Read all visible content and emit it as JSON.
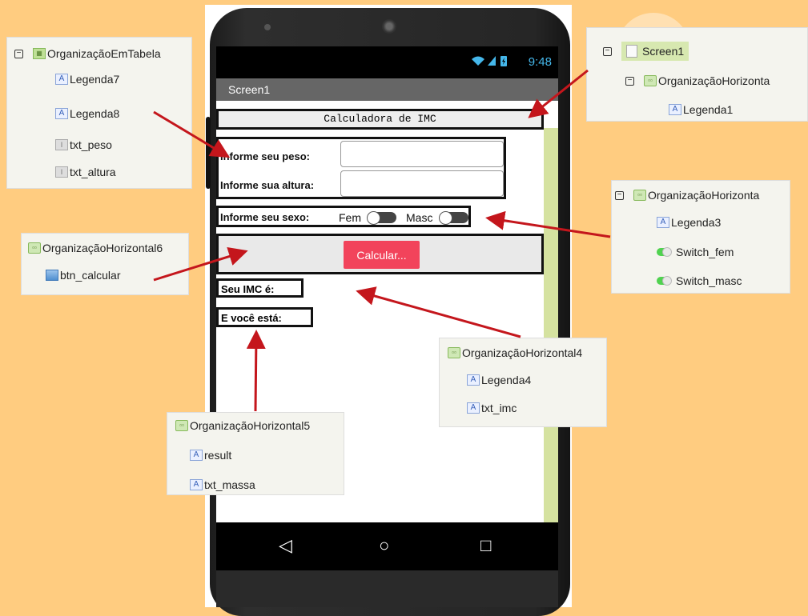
{
  "phone": {
    "status_time": "9:48",
    "status_icons": "signal-wifi-battery-icons",
    "screen_title": "Screen1",
    "app_title": "Calculadora de IMC",
    "form": {
      "peso_label": "Informe seu peso:",
      "altura_label": "Informe sua altura:",
      "sexo_label": "Informe seu sexo:",
      "fem_label": "Fem",
      "masc_label": "Masc"
    },
    "calc_button": "Calcular...",
    "imc_label": "Seu IMC é:",
    "massa_label": "E você está:",
    "nav": {
      "back": "◁",
      "home": "○",
      "recent": "□"
    }
  },
  "panels": {
    "tabela": {
      "title": "OrganizaçãoEmTabela",
      "children": [
        "Legenda7",
        "Legenda8",
        "txt_peso",
        "txt_altura"
      ]
    },
    "screen": {
      "title": "Screen1",
      "child": "OrganizaçãoHorizonta",
      "grandchild": "Legenda1"
    },
    "sexo": {
      "title": "OrganizaçãoHorizonta",
      "children": [
        "Legenda3",
        "Switch_fem",
        "Switch_masc"
      ]
    },
    "h6": {
      "title": "OrganizaçãoHorizontal6",
      "children": [
        "btn_calcular"
      ]
    },
    "h4": {
      "title": "OrganizaçãoHorizontal4",
      "children": [
        "Legenda4",
        "txt_imc"
      ]
    },
    "h5": {
      "title": "OrganizaçãoHorizontal5",
      "children": [
        "result",
        "txt_massa"
      ]
    }
  },
  "colors": {
    "background": "#ffcc80",
    "arrow": "#c4161c",
    "calc_button": "#f2435b",
    "status_text": "#45b7ea"
  }
}
